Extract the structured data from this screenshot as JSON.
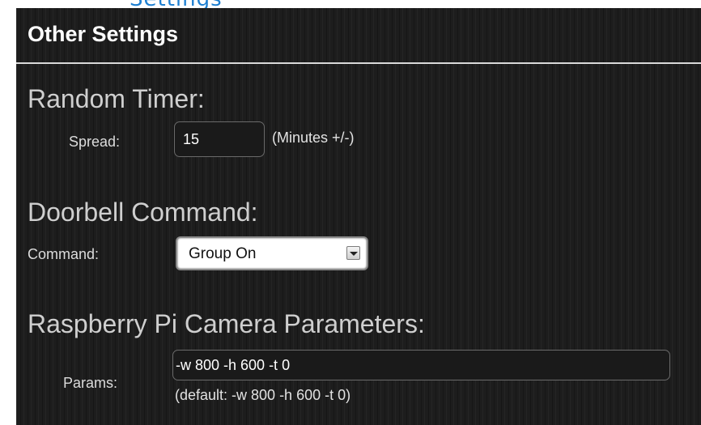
{
  "page": {
    "clipped_heading": "Settings"
  },
  "panel": {
    "title": "Other Settings"
  },
  "random_timer": {
    "heading": "Random Timer:",
    "spread_label": "Spread:",
    "spread_value": "15",
    "spread_hint": "(Minutes +/-)"
  },
  "doorbell": {
    "heading": "Doorbell Command:",
    "command_label": "Command:",
    "command_selected": "Group On"
  },
  "camera": {
    "heading": "Raspberry Pi Camera Parameters:",
    "params_label": "Params:",
    "params_value": "-w 800 -h 600 -t 0",
    "params_hint": "(default: -w 800 -h 600 -t 0)"
  },
  "colors": {
    "panel_background": "#1d1d1d",
    "heading_text": "#cfcfcf",
    "link_blue": "#1d7fd1"
  }
}
